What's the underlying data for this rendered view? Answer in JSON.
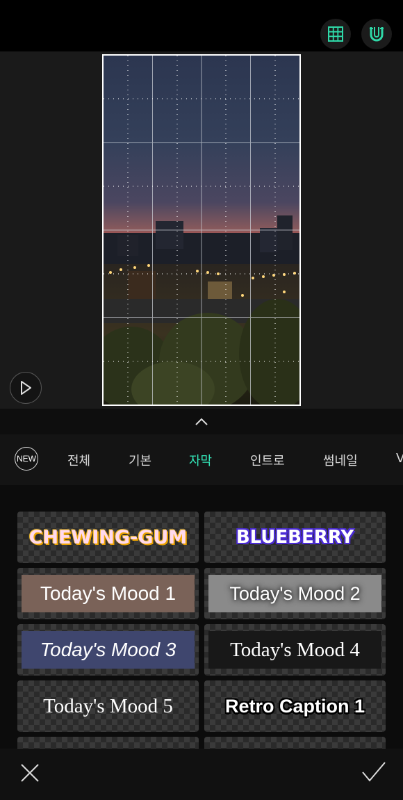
{
  "toolbar": {
    "grid_icon": "grid-icon",
    "magnet_icon": "magnet-icon",
    "accent_color": "#2fd9a8"
  },
  "preview": {
    "play_icon": "play-icon",
    "collapse_icon": "chevron-up-icon"
  },
  "tabs": {
    "new_label": "NEW",
    "items": [
      {
        "label": "전체"
      },
      {
        "label": "기본"
      },
      {
        "label": "자막"
      },
      {
        "label": "인트로"
      },
      {
        "label": "썸네일"
      },
      {
        "label": "V"
      }
    ],
    "active_index": 2,
    "active_color": "#33e6b8"
  },
  "templates": [
    {
      "label": "CHEWING-GUM"
    },
    {
      "label": "BLUEBERRY"
    },
    {
      "label": "Today's Mood 1"
    },
    {
      "label": "Today's Mood 2"
    },
    {
      "label": "Today's Mood 3"
    },
    {
      "label": "Today's Mood 4"
    },
    {
      "label": "Today's Mood 5"
    },
    {
      "label": "Retro Caption 1"
    }
  ],
  "bottom": {
    "close_icon": "close-icon",
    "confirm_icon": "check-icon"
  }
}
